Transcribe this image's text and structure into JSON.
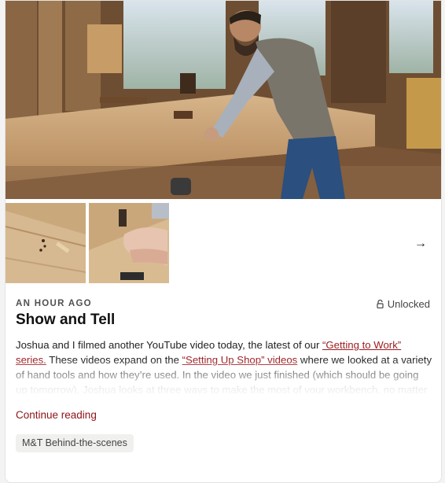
{
  "post": {
    "timestamp": "AN HOUR AGO",
    "access": "Unlocked",
    "title": "Show and Tell",
    "excerpt": {
      "part1": "Joshua and I filmed another YouTube video today, the latest of our ",
      "link1": "“Getting to Work” series.",
      "part2": " These videos expand on the ",
      "link2": "“Setting Up Shop” videos",
      "part3": " where we looked at a variety of hand tools and how they’re used. In the video we just finished (which should be going up tomorrow), Joshua looks at three ways to make the most of your workbench, no matter"
    },
    "continue_label": "Continue reading",
    "tag": "M&T Behind-the-scenes",
    "next_arrow": "→"
  },
  "icons": {
    "lock": "lock-open-icon",
    "arrow": "arrow-right-icon"
  },
  "colors": {
    "link": "#9b1b1f",
    "continue": "#8c1418",
    "tag_bg": "#f0f0ee"
  }
}
